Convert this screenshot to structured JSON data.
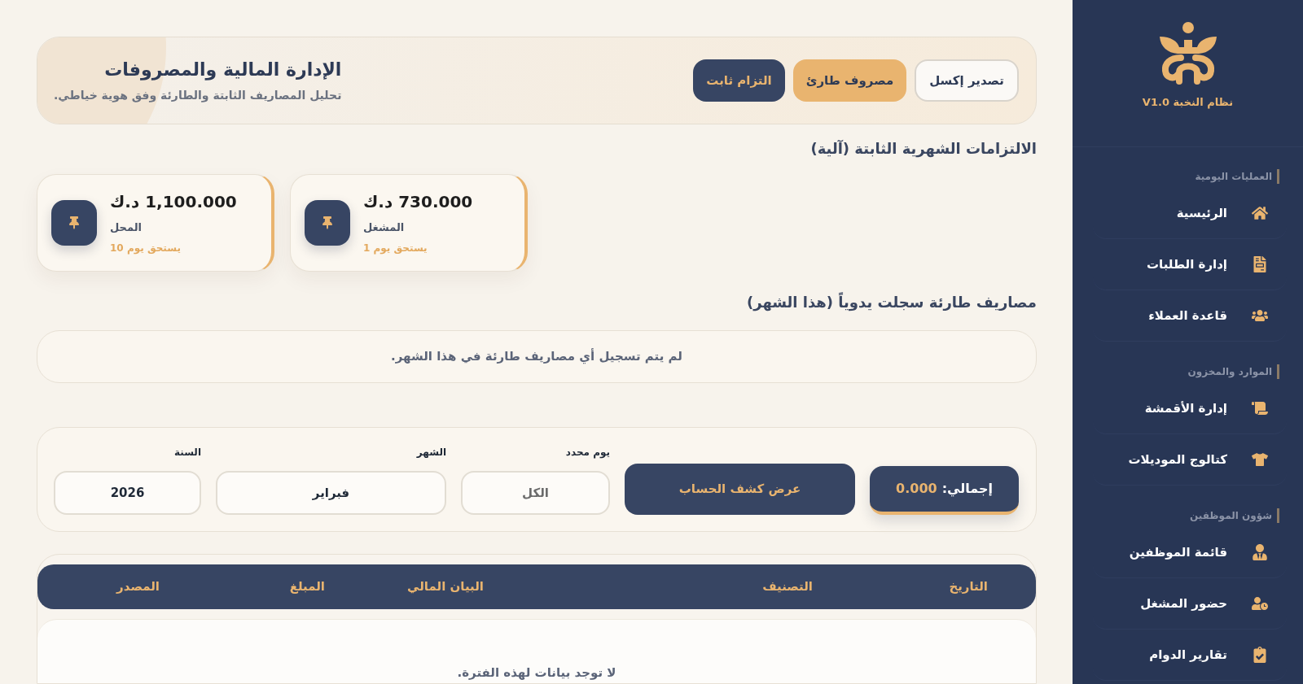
{
  "sidebar": {
    "app_name": "نظام النخبة V1.0",
    "sections": [
      {
        "title": "العمليات اليومية",
        "items": [
          {
            "label": "الرئيسية",
            "selected": false
          },
          {
            "label": "إدارة الطلبات",
            "selected": false
          },
          {
            "label": "قاعدة العملاء",
            "selected": false
          }
        ]
      },
      {
        "title": "الموارد والمخزون",
        "items": [
          {
            "label": "إدارة الأقمشة",
            "selected": false
          },
          {
            "label": "كتالوج الموديلات",
            "selected": false
          }
        ]
      },
      {
        "title": "شؤون الموظفين",
        "items": [
          {
            "label": "قائمة الموظفين",
            "selected": false
          },
          {
            "label": "حضور المشغل",
            "selected": false
          },
          {
            "label": "تقارير الدوام",
            "selected": false
          }
        ]
      }
    ]
  },
  "header": {
    "title": "الإدارة المالية والمصروفات",
    "subtitle": "تحليل المصاريف الثابتة والطارئة وفق هوية خياطي.",
    "buttons": [
      {
        "label": "تصدير إكسل",
        "kind": "outline"
      },
      {
        "label": "مصروف طارئ",
        "kind": "gold"
      },
      {
        "label": "التزام ثابت",
        "kind": "navy"
      }
    ]
  },
  "fixed_commitments": {
    "heading": "الالتزامات الشهرية الثابتة (آلية)",
    "cards": [
      {
        "amount": "730.000 د.ك",
        "label": "المشغل",
        "due": "يستحق يوم 1"
      },
      {
        "amount": "1,100.000 د.ك",
        "label": "المحل",
        "due": "يستحق يوم 10"
      }
    ]
  },
  "emergency_expenses": {
    "heading": "مصاريف طارئة سجلت يدوياً (هذا الشهر)",
    "empty_message": "لم يتم تسجيل أي مصاريف طارئة في هذا الشهر."
  },
  "filters": {
    "total": {
      "label": "إجمالي:",
      "value": "0.000"
    },
    "statement_button": "عرض كشف الحساب",
    "fields": [
      {
        "label": "يوم محدد",
        "placeholder": "الكل"
      },
      {
        "label": "الشهر",
        "value": "فبراير"
      },
      {
        "label": "السنة",
        "value": "2026"
      }
    ]
  },
  "table": {
    "columns": [
      "التاريخ",
      "التصنيف",
      "البيان المالي",
      "المبلغ",
      "المصدر"
    ],
    "empty_message": "لا توجد بيانات لهذه الفترة."
  }
}
